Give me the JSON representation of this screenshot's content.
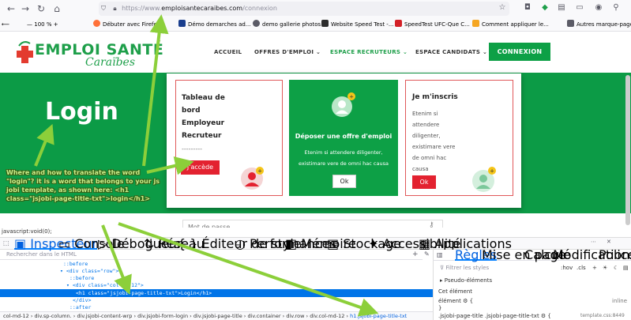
{
  "browser": {
    "url_scheme": "https://",
    "url_prefix": "www.",
    "url_host": "emploisantecaraibes.com",
    "url_path": "/connexion",
    "zoom": "100 %",
    "bookmarks": [
      {
        "label": "Débuter avec Firefox",
        "color": "#ff7139"
      },
      {
        "label": "Démo demarches ad...",
        "color": "#1a3e8e"
      },
      {
        "label": "demo gallerie photos",
        "color": "#5b5b66"
      },
      {
        "label": "Website Speed Test -...",
        "color": "#2d2d2d"
      },
      {
        "label": "SpeedTest UFC-Que C...",
        "color": "#d32027"
      },
      {
        "label": "Comment appliquer le...",
        "color": "#f5a623"
      },
      {
        "label": "Autres marque-page",
        "color": "#5b5b66"
      }
    ]
  },
  "site": {
    "logo_main": "EMPLOI SANTÉ",
    "logo_sub": "Caraïbes",
    "menu": [
      {
        "label": "ACCUEIL",
        "active": false
      },
      {
        "label": "OFFRES D'EMPLOI ⌄",
        "active": false
      },
      {
        "label": "ESPACE RECRUTEURS ⌄",
        "active": true
      },
      {
        "label": "ESPACE CANDIDATS ⌄",
        "active": false
      }
    ],
    "connexion_label": "CONNEXION",
    "hero_title": "Login",
    "password_placeholder": "Mot de passe"
  },
  "cards": {
    "card1": {
      "title_lines": [
        "Tableau de",
        "bord",
        "Employeur",
        "Recruteur"
      ],
      "dashes": "---------",
      "button": "J'accède"
    },
    "card2": {
      "title": "Déposer une offre d'emploi",
      "text_lines": [
        "Etenim si attendere diligenter,",
        "existimare vere de omni hac causa"
      ],
      "button": "Ok"
    },
    "card3": {
      "title": "Je m'inscris",
      "text_lines": [
        "Etenim si",
        "attendere",
        "diligenter,",
        "existimare vere",
        "de omni hac",
        "causa"
      ],
      "button": "Ok"
    }
  },
  "annotation": {
    "text": "Where and how to translate the word \"login\"? it is a word that belongs to your js jobi template, as shown here: <h1 class=\"jsjobi-page-title-txt\">login</h1>"
  },
  "devtools": {
    "js_line": "javascript:void(0);",
    "tabs": [
      "Inspecteur",
      "Console",
      "Débogueur",
      "Réseau",
      "Éditeur de style",
      "Performances",
      "Mémoire",
      "Stockage",
      "Accessibilité",
      "Applications"
    ],
    "search_placeholder": "Rechercher dans le HTML",
    "code_lines": [
      {
        "indent": 80,
        "text": "::before"
      },
      {
        "indent": 76,
        "text": "▾ <div class=\"row\">"
      },
      {
        "indent": 88,
        "text": "::before"
      },
      {
        "indent": 84,
        "text": "▾ <div class=\"col-md-12\">"
      },
      {
        "indent": 96,
        "text": "<h1 class=\"jsjobi-page-title-txt\">Login</h1>"
      },
      {
        "indent": 92,
        "text": "</div>"
      },
      {
        "indent": 88,
        "text": "::after"
      }
    ],
    "breadcrumbs": [
      "col-md-12",
      "div.sp-column.",
      "div.jsjobi-content-wrp",
      "div.jsjobi-form-login",
      "div.jsjobi-page-title",
      "div.container",
      "div.row",
      "div.col-md-12",
      "h1.jsjobi-page-title-txt"
    ],
    "right_tabs": [
      "Règles",
      "Mise en page",
      "Calculé",
      "Modifications",
      "Polices"
    ],
    "filter_placeholder": "Filtrer les styles",
    "hov": ":hov",
    "cls": ".cls",
    "pseudo": "Pseudo-éléments",
    "this_element": "Cet élément",
    "element_rule": "élément ⚙ {",
    "element_rule_source": "inline",
    "close_brace": "}",
    "selector_rule": ".jsjobi-page-title .jsjobi-page-title-txt ⚙ {",
    "selector_source": "template.css:8449"
  },
  "colors": {
    "green": "#0da046",
    "red": "#e32230",
    "arrow": "#8ccf3a"
  }
}
